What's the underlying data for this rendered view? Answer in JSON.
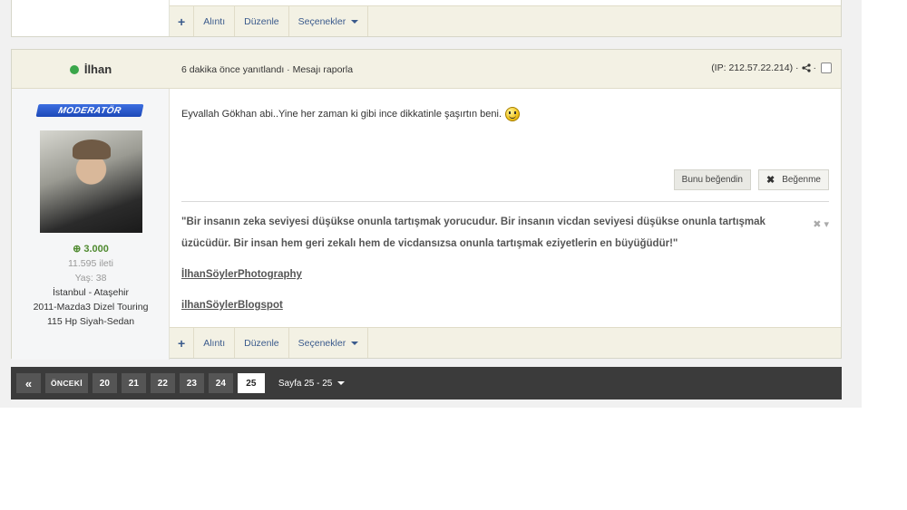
{
  "top_post": {
    "toolbar": {
      "plus": "+",
      "quote": "Alıntı",
      "edit": "Düzenle",
      "options": "Seçenekler"
    }
  },
  "post": {
    "username": "İlhan",
    "meta": "6 dakika önce yanıtlandı · Mesajı raporla",
    "ip": "(IP: 212.57.22.214) ·",
    "role_badge": "MODERATÖR",
    "points": "3.000",
    "posts": "11.595 ileti",
    "age": "Yaş: 38",
    "location": "İstanbul - Ataşehir",
    "car_line1": "2011-Mazda3 Dizel Touring",
    "car_line2": "115 Hp Siyah-Sedan",
    "message": "Eyvallah Gökhan abi..Yine her zaman ki gibi ince dikkatinle şaşırtın beni.",
    "like_label": "Bunu beğendin",
    "unlike_label": "Beğenme",
    "signature_quote": "\"Bir insanın zeka seviyesi düşükse onunla tartışmak yorucudur. Bir insanın vicdan seviyesi düşükse onunla tartışmak üzücüdür. Bir insan hem geri zekalı hem de vicdansızsa onunla tartışmak eziyetlerin en büyüğüdür!\"",
    "signature_link1": "İlhanSöylerPhotography",
    "signature_link2": "ilhanSöylerBlogspot",
    "toolbar": {
      "plus": "+",
      "quote": "Alıntı",
      "edit": "Düzenle",
      "options": "Seçenekler"
    }
  },
  "pager": {
    "first": "«",
    "prev": "ÖNCEKİ",
    "pages": [
      "20",
      "21",
      "22",
      "23",
      "24"
    ],
    "current": "25",
    "page_info": "Sayfa 25 - 25"
  },
  "colors": {
    "online": "#3aa64a",
    "header_bg": "#f3f1e4",
    "pager_bg": "#3b3b3b",
    "badge_blue": "#2a5ccf",
    "points_green": "#4f8a2f"
  }
}
